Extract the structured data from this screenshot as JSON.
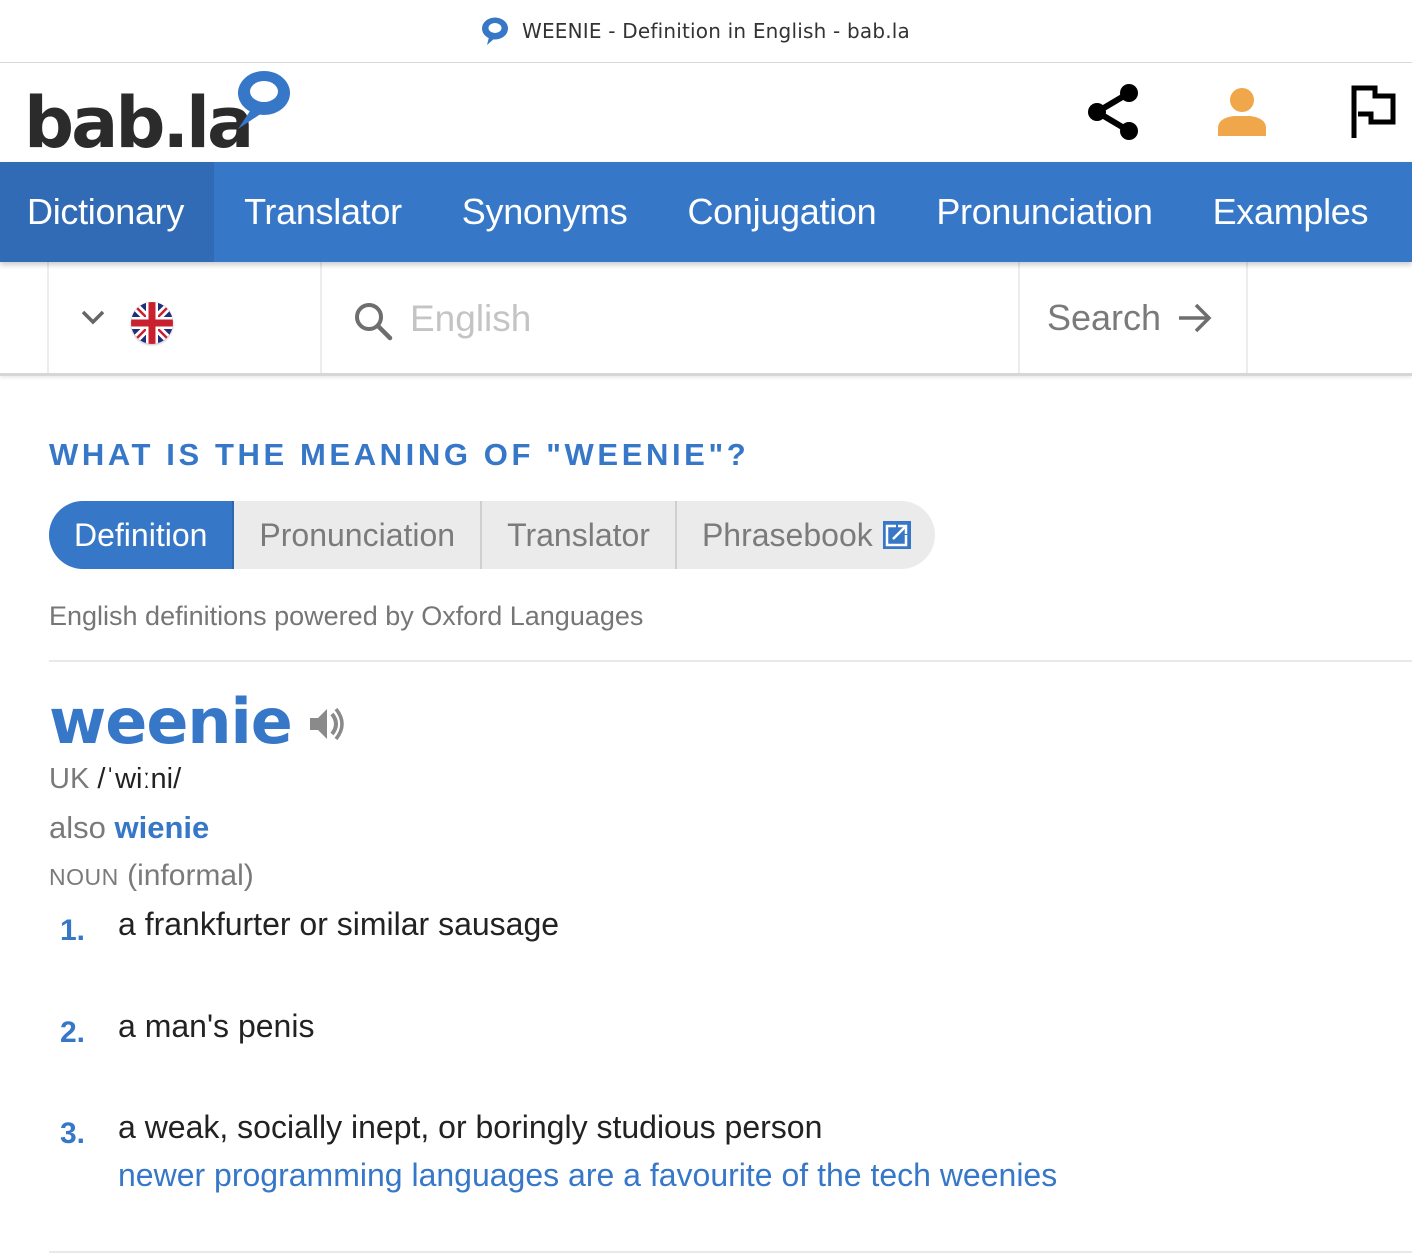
{
  "browser": {
    "tab_title": "WEENIE - Definition in English - bab.la"
  },
  "header": {
    "logo_text": "bab.la",
    "icons": {
      "share": "share-icon",
      "user": "user-icon",
      "flag": "flag-icon"
    },
    "colors": {
      "brand_blue": "#3777c8",
      "user_icon": "#f0a64a"
    }
  },
  "nav": {
    "items": [
      {
        "label": "Dictionary",
        "active": true
      },
      {
        "label": "Translator",
        "active": false
      },
      {
        "label": "Synonyms",
        "active": false
      },
      {
        "label": "Conjugation",
        "active": false
      },
      {
        "label": "Pronunciation",
        "active": false
      },
      {
        "label": "Examples",
        "active": false
      }
    ]
  },
  "search": {
    "language_flag": "uk-flag",
    "placeholder": "English",
    "value": "",
    "button_label": "Search"
  },
  "content": {
    "heading": "WHAT IS THE MEANING OF \"WEENIE\"?",
    "tabs": [
      {
        "label": "Definition",
        "active": true
      },
      {
        "label": "Pronunciation",
        "active": false
      },
      {
        "label": "Translator",
        "active": false
      },
      {
        "label": "Phrasebook",
        "active": false,
        "external": true
      }
    ],
    "powered_by": "English definitions powered by Oxford Languages",
    "entry": {
      "headword": "weenie",
      "pron_label": "UK",
      "ipa": "/ˈwiːni/",
      "also_label": "also",
      "also_word": "wienie",
      "pos": "NOUN",
      "register": "(informal)",
      "senses": [
        {
          "num": "1.",
          "definition": "a frankfurter or similar sausage"
        },
        {
          "num": "2.",
          "definition": "a man's penis"
        },
        {
          "num": "3.",
          "definition": "a weak, socially inept, or boringly studious person",
          "example": "newer programming languages are a favourite of the tech weenies"
        }
      ]
    }
  }
}
